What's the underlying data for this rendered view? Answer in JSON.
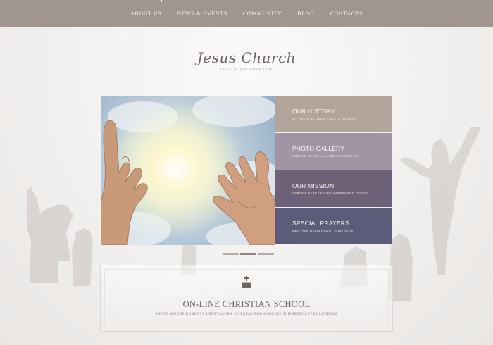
{
  "nav": {
    "items": [
      {
        "label": "About us"
      },
      {
        "label": "News & Events"
      },
      {
        "label": "Community"
      },
      {
        "label": "Blog"
      },
      {
        "label": "Contacts"
      }
    ]
  },
  "logo": {
    "title": "Jesus Church",
    "tagline": "Love God & Love Life"
  },
  "panels": [
    {
      "title": "Our History",
      "subtitle": "Sit avertas dero asento nandal",
      "color": "#b3a49b"
    },
    {
      "title": "Photo Gallery",
      "subtitle": "Asento nandala mabeav ducuutal",
      "color": "#a293a5"
    },
    {
      "title": "Our Mission",
      "subtitle": "Verode fase lasuse avertilero ferosi",
      "color": "#6d6277"
    },
    {
      "title": "Special Prayers",
      "subtitle": "Mertase delis neory kastreas",
      "color": "#5b5b7a"
    }
  ],
  "slider": {
    "count": 3,
    "active_index": 1
  },
  "school": {
    "title": "On-line Christian School",
    "text": "Sants muede rarecta lertyasera su expacabonemo enim ipsertolupta luretas",
    "icon": "bible-cross-icon"
  },
  "colors": {
    "nav_bg": "#a0958f",
    "text_dark": "#6e6461"
  }
}
